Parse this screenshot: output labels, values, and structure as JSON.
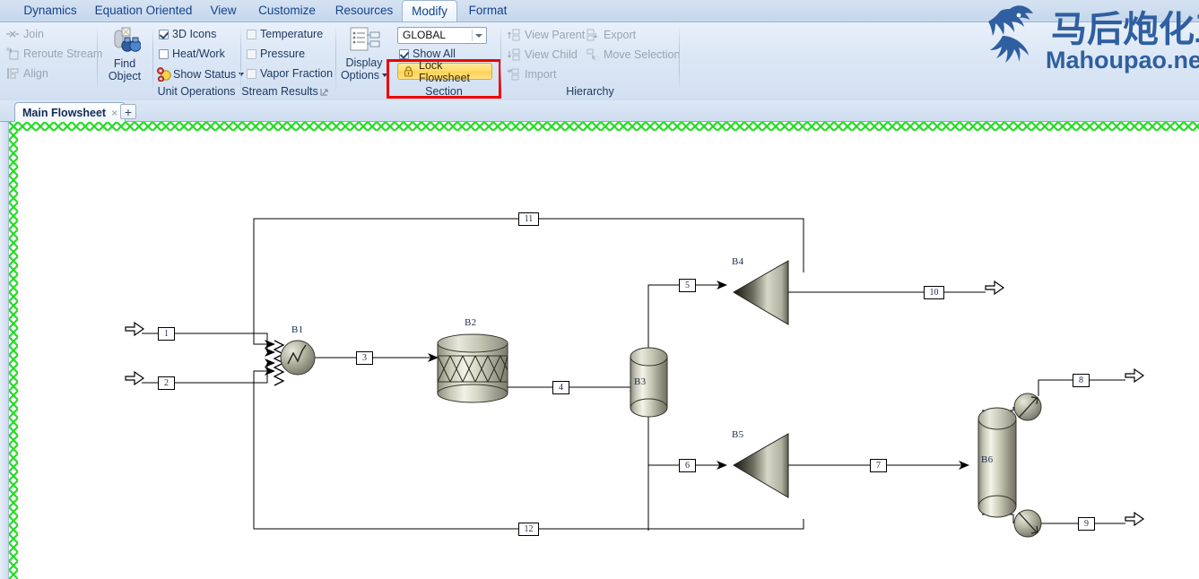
{
  "ribbon": {
    "tabs": [
      {
        "label": "Dynamics",
        "active": false
      },
      {
        "label": "Equation Oriented",
        "active": false
      },
      {
        "label": "View",
        "active": false
      },
      {
        "label": "Customize",
        "active": false
      },
      {
        "label": "Resources",
        "active": false
      },
      {
        "label": "Modify",
        "active": true
      },
      {
        "label": "Format",
        "active": false
      }
    ],
    "groups": [
      {
        "title": "",
        "commands": [
          "Join",
          "Reroute Stream",
          "Align"
        ]
      },
      {
        "title": "",
        "commands": [
          "Find Object"
        ]
      },
      {
        "title": "Unit Operations",
        "commands": [
          "3D Icons",
          "Heat/Work",
          "Show Status"
        ]
      },
      {
        "title": "Stream Results",
        "commands": [
          "Temperature",
          "Pressure",
          "Vapor Fraction"
        ]
      },
      {
        "title": "Section",
        "commands": [
          "Display Options",
          "GLOBAL",
          "Show All",
          "Lock Flowsheet"
        ]
      },
      {
        "title": "Hierarchy",
        "commands": [
          "View Parent",
          "View Child",
          "Import",
          "Export",
          "Move Selection"
        ]
      }
    ],
    "join_label": "Join",
    "reroute_label": "Reroute Stream",
    "align_label": "Align",
    "find_object_label_1": "Find",
    "find_object_label_2": "Object",
    "icons_3d_label": "3D Icons",
    "heat_work_label": "Heat/Work",
    "show_status_label": "Show Status",
    "unit_operations_title": "Unit Operations",
    "temperature_label": "Temperature",
    "pressure_label": "Pressure",
    "vapor_fraction_label": "Vapor Fraction",
    "stream_results_title": "Stream Results",
    "display_options_label_1": "Display",
    "display_options_label_2": "Options",
    "global_combo_value": "GLOBAL",
    "show_all_label": "Show All",
    "lock_flowsheet_label": "Lock Flowsheet",
    "section_title": "Section",
    "view_parent_label": "View Parent",
    "view_child_label": "View Child",
    "import_label": "Import",
    "export_label": "Export",
    "move_selection_label": "Move Selection",
    "hierarchy_title": "Hierarchy",
    "checkbox_states": {
      "icons_3d": true,
      "heat_work": false,
      "temperature": false,
      "pressure": false,
      "vapor_fraction": false,
      "show_all": true
    },
    "highlight_color": "#ee0000",
    "accent_color": "#15428b"
  },
  "logo": {
    "chinese_text": "马后炮化工",
    "site_text": "Mahoupao.net",
    "color": "#2f5fa0"
  },
  "document_tabs": {
    "active_tab": "Main Flowsheet",
    "close_glyph": "×",
    "add_glyph": "+"
  },
  "flowsheet": {
    "border_color": "#22dd22",
    "blocks": [
      {
        "id": "B1",
        "label": "B1",
        "type": "mixer"
      },
      {
        "id": "B2",
        "label": "B2",
        "type": "packed-reactor"
      },
      {
        "id": "B3",
        "label": "B3",
        "type": "vessel"
      },
      {
        "id": "B4",
        "label": "B4",
        "type": "compressor"
      },
      {
        "id": "B5",
        "label": "B5",
        "type": "compressor"
      },
      {
        "id": "B6",
        "label": "B6",
        "type": "distillation-column"
      }
    ],
    "streams": [
      {
        "id": "1",
        "label": "1",
        "kind": "feed"
      },
      {
        "id": "2",
        "label": "2",
        "kind": "feed"
      },
      {
        "id": "3",
        "label": "3",
        "kind": "internal"
      },
      {
        "id": "4",
        "label": "4",
        "kind": "internal"
      },
      {
        "id": "5",
        "label": "5",
        "kind": "internal"
      },
      {
        "id": "6",
        "label": "6",
        "kind": "internal"
      },
      {
        "id": "7",
        "label": "7",
        "kind": "internal"
      },
      {
        "id": "8",
        "label": "8",
        "kind": "product"
      },
      {
        "id": "9",
        "label": "9",
        "kind": "product"
      },
      {
        "id": "10",
        "label": "10",
        "kind": "product"
      },
      {
        "id": "11",
        "label": "11",
        "kind": "recycle"
      },
      {
        "id": "12",
        "label": "12",
        "kind": "recycle"
      }
    ]
  }
}
